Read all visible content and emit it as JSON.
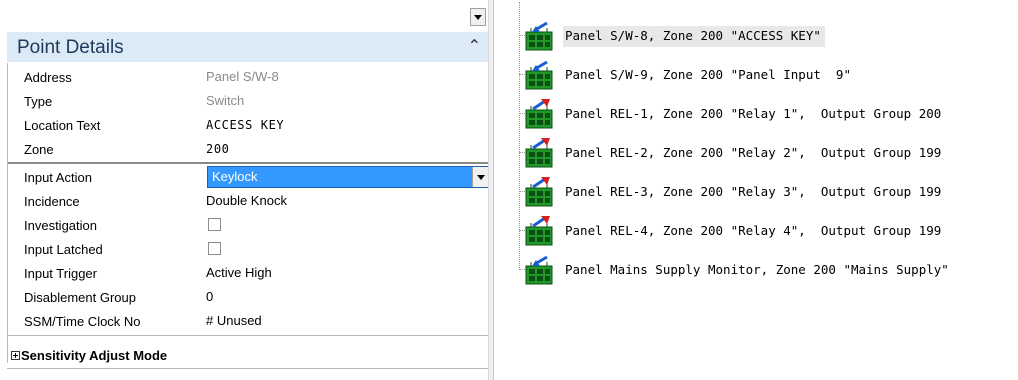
{
  "point_details": {
    "title": "Point Details",
    "rows": [
      {
        "label": "Address",
        "value": "Panel S/W-8"
      },
      {
        "label": "Type",
        "value": "Switch"
      },
      {
        "label": "Location Text",
        "value": "ACCESS KEY"
      },
      {
        "label": "Zone",
        "value": "200"
      },
      {
        "label": "Input Action",
        "value": "Keylock"
      },
      {
        "label": "Incidence",
        "value": "Double Knock"
      },
      {
        "label": "Investigation",
        "checked": false
      },
      {
        "label": "Input Latched",
        "checked": false
      },
      {
        "label": "Input Trigger",
        "value": "Active High"
      },
      {
        "label": "Disablement Group",
        "value": "0"
      },
      {
        "label": "SSM/Time Clock No",
        "value": "# Unused"
      }
    ],
    "collapsed_category": "Sensitivity Adjust Mode"
  },
  "tree": {
    "items": [
      {
        "text": "Panel S/W-8, Zone 200 \"ACCESS KEY\"",
        "icon": "input-point-icon",
        "selected": true
      },
      {
        "text": "Panel S/W-9, Zone 200 \"Panel Input  9\"",
        "icon": "input-point-icon"
      },
      {
        "text": "Panel REL-1, Zone 200 \"Relay 1\",  Output Group 200",
        "icon": "output-relay-icon"
      },
      {
        "text": "Panel REL-2, Zone 200 \"Relay 2\",  Output Group 199",
        "icon": "output-relay-icon"
      },
      {
        "text": "Panel REL-3, Zone 200 \"Relay 3\",  Output Group 199",
        "icon": "output-relay-icon"
      },
      {
        "text": "Panel REL-4, Zone 200 \"Relay 4\",  Output Group 199",
        "icon": "output-relay-icon"
      },
      {
        "text": "Panel Mains Supply Monitor, Zone 200 \"Mains Supply\"",
        "icon": "input-point-icon"
      }
    ]
  }
}
